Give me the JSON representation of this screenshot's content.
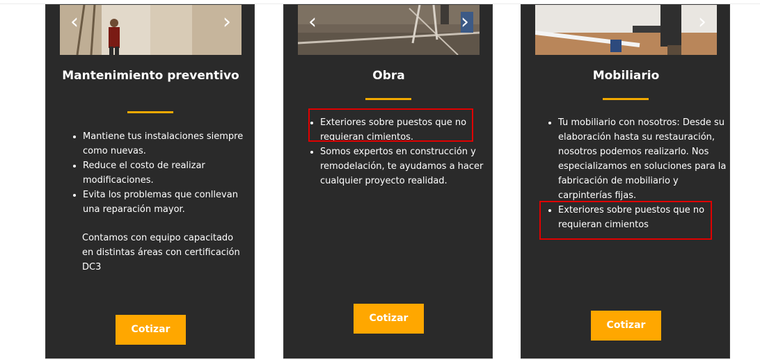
{
  "colors": {
    "card_bg": "#2a2a2a",
    "accent": "#f2a900",
    "button": "#ffa700",
    "highlight": "#e00000"
  },
  "cards": [
    {
      "title": "Mantenimiento preventivo",
      "items": [
        "Mantiene tus instalaciones siempre como nuevas.",
        "Reduce el costo de realizar modificaciones.",
        "Evita los problemas que conllevan una reparación mayor."
      ],
      "extra": "Contamos con equipo capacitado en distintas áreas con certificación DC3",
      "button": "Cotizar",
      "prev_icon": "chevron-left-icon",
      "next_icon": "chevron-right-icon"
    },
    {
      "title": "Obra",
      "items": [
        "Exteriores sobre puestos que no requieran cimientos.",
        "Somos expertos en construcción y remodelación, te ayudamos a hacer cualquier proyecto realidad."
      ],
      "button": "Cotizar",
      "prev_icon": "chevron-left-icon",
      "next_icon": "chevron-right-icon"
    },
    {
      "title": "Mobiliario",
      "items": [
        "Tu mobiliario con nosotros: Desde su elaboración hasta su restauración, nosotros podemos realizarlo. Nos especializamos en soluciones para la fabricación de mobiliario y carpinterías fijas.",
        "Exteriores sobre puestos que no requieran cimientos"
      ],
      "button": "Cotizar",
      "next_icon": "chevron-right-icon"
    }
  ]
}
